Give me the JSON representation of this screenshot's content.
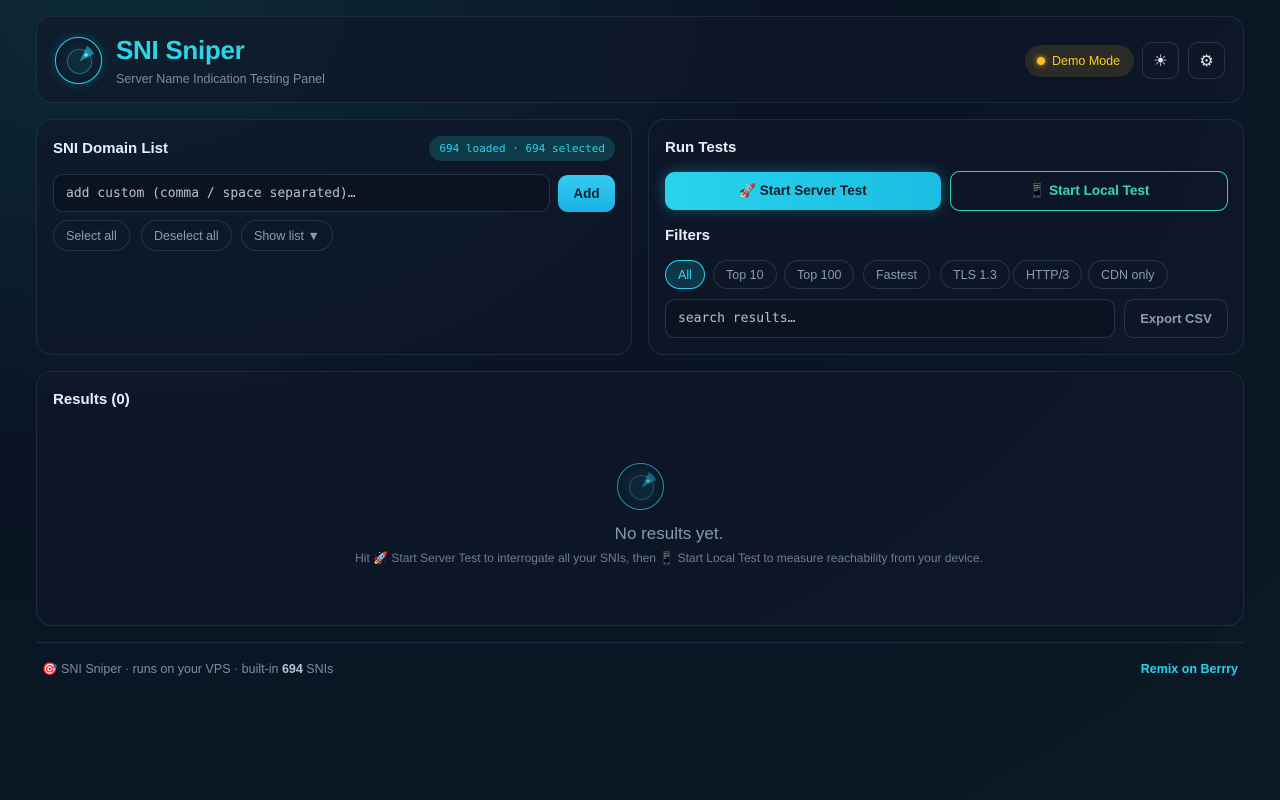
{
  "header": {
    "title": "SNI Sniper",
    "subtitle": "Server Name Indication Testing Panel",
    "demo_mode_label": "Demo Mode",
    "theme_icon": "☀",
    "settings_icon": "⚙"
  },
  "sni_list": {
    "title": "SNI Domain List",
    "counter": "694 loaded · 694 selected",
    "input_placeholder": "add custom (comma / space separated)…",
    "add_label": "Add",
    "select_all_label": "Select all",
    "deselect_all_label": "Deselect all",
    "show_list_label": "Show list ▼"
  },
  "run_tests": {
    "title": "Run Tests",
    "server_test_label": "🚀 Start Server Test",
    "local_test_label": "📱 Start Local Test",
    "filters_title": "Filters",
    "filters": [
      "All",
      "Top 10",
      "Top 100",
      "Fastest",
      "TLS 1.3",
      "HTTP/3",
      "CDN only"
    ],
    "active_filter": "All",
    "search_placeholder": "search results…",
    "export_label": "Export CSV"
  },
  "results": {
    "title": "Results (0)",
    "empty_title": "No results yet.",
    "empty_sub": "Hit 🚀 Start Server Test to interrogate all your SNIs, then 📱 Start Local Test to measure reachability from your device."
  },
  "footer": {
    "prefix": "🎯 SNI Sniper · runs on your VPS · built-in ",
    "count": "694",
    "suffix": " SNIs",
    "remix_label": "Remix on Berrry"
  },
  "colors": {
    "accent": "#22d3ee",
    "local_accent": "#2dd4a8",
    "demo": "#facc15"
  }
}
